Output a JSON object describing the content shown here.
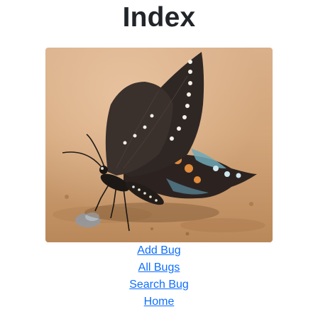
{
  "page": {
    "title": "Index"
  },
  "image": {
    "subject": "butterfly-photo"
  },
  "links": [
    {
      "label": "Add Bug"
    },
    {
      "label": "All Bugs"
    },
    {
      "label": "Search Bug"
    },
    {
      "label": "Home"
    }
  ],
  "colors": {
    "link": "#0d6efd",
    "heading": "#212529",
    "background": "#ffffff"
  }
}
